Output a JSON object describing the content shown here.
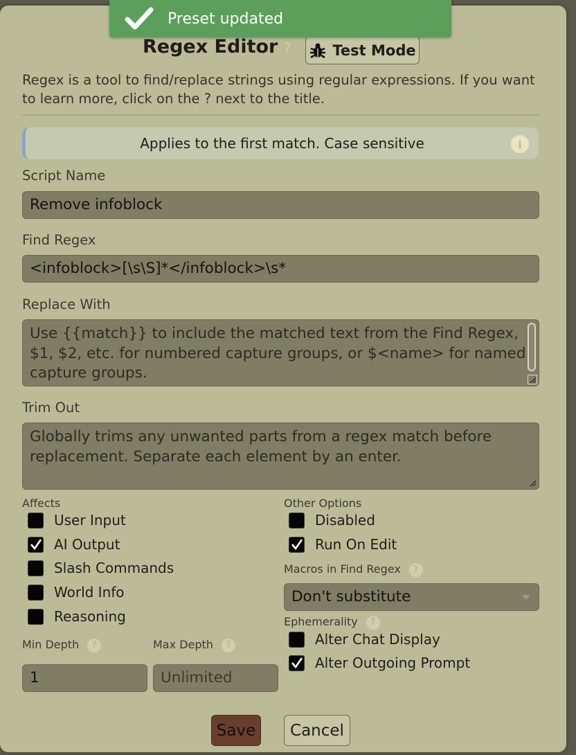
{
  "toast": {
    "message": "Preset updated",
    "icon": "check-icon",
    "color": "#5b9f5b"
  },
  "header": {
    "title": "Regex Editor",
    "help": "?",
    "test_mode_label": "Test Mode",
    "test_mode_icon": "bug-icon"
  },
  "description": "Regex is a tool to find/replace strings using regular expressions. If you want to learn more, click on the ? next to the title.",
  "info": {
    "text": "Applies to the first match. Case sensitive",
    "icon": "i"
  },
  "script_name": {
    "label": "Script Name",
    "value": "Remove infoblock"
  },
  "find_regex": {
    "label": "Find Regex",
    "value": "<infoblock>[\\s\\S]*</infoblock>\\s*"
  },
  "replace_with": {
    "label": "Replace With",
    "placeholder": "Use {{match}} to include the matched text from the Find Regex, $1, $2, etc. for numbered capture groups, or $<name> for named capture groups."
  },
  "trim_out": {
    "label": "Trim Out",
    "placeholder": "Globally trims any unwanted parts from a regex match before replacement. Separate each element by an enter."
  },
  "affects": {
    "label": "Affects",
    "items": [
      {
        "label": "User Input",
        "checked": false
      },
      {
        "label": "AI Output",
        "checked": true
      },
      {
        "label": "Slash Commands",
        "checked": false
      },
      {
        "label": "World Info",
        "checked": false
      },
      {
        "label": "Reasoning",
        "checked": false
      }
    ]
  },
  "other_options": {
    "label": "Other Options",
    "items": [
      {
        "label": "Disabled",
        "checked": false
      },
      {
        "label": "Run On Edit",
        "checked": true
      }
    ]
  },
  "macros": {
    "label": "Macros in Find Regex",
    "help": "?",
    "selected": "Don't substitute"
  },
  "ephemerality": {
    "label": "Ephemerality",
    "help": "?",
    "items": [
      {
        "label": "Alter Chat Display",
        "checked": false
      },
      {
        "label": "Alter Outgoing Prompt",
        "checked": true
      }
    ]
  },
  "depth": {
    "min_label": "Min Depth",
    "min_help": "?",
    "min_value": "1",
    "max_label": "Max Depth",
    "max_help": "?",
    "max_placeholder": "Unlimited"
  },
  "footer": {
    "save_label": "Save",
    "cancel_label": "Cancel"
  }
}
